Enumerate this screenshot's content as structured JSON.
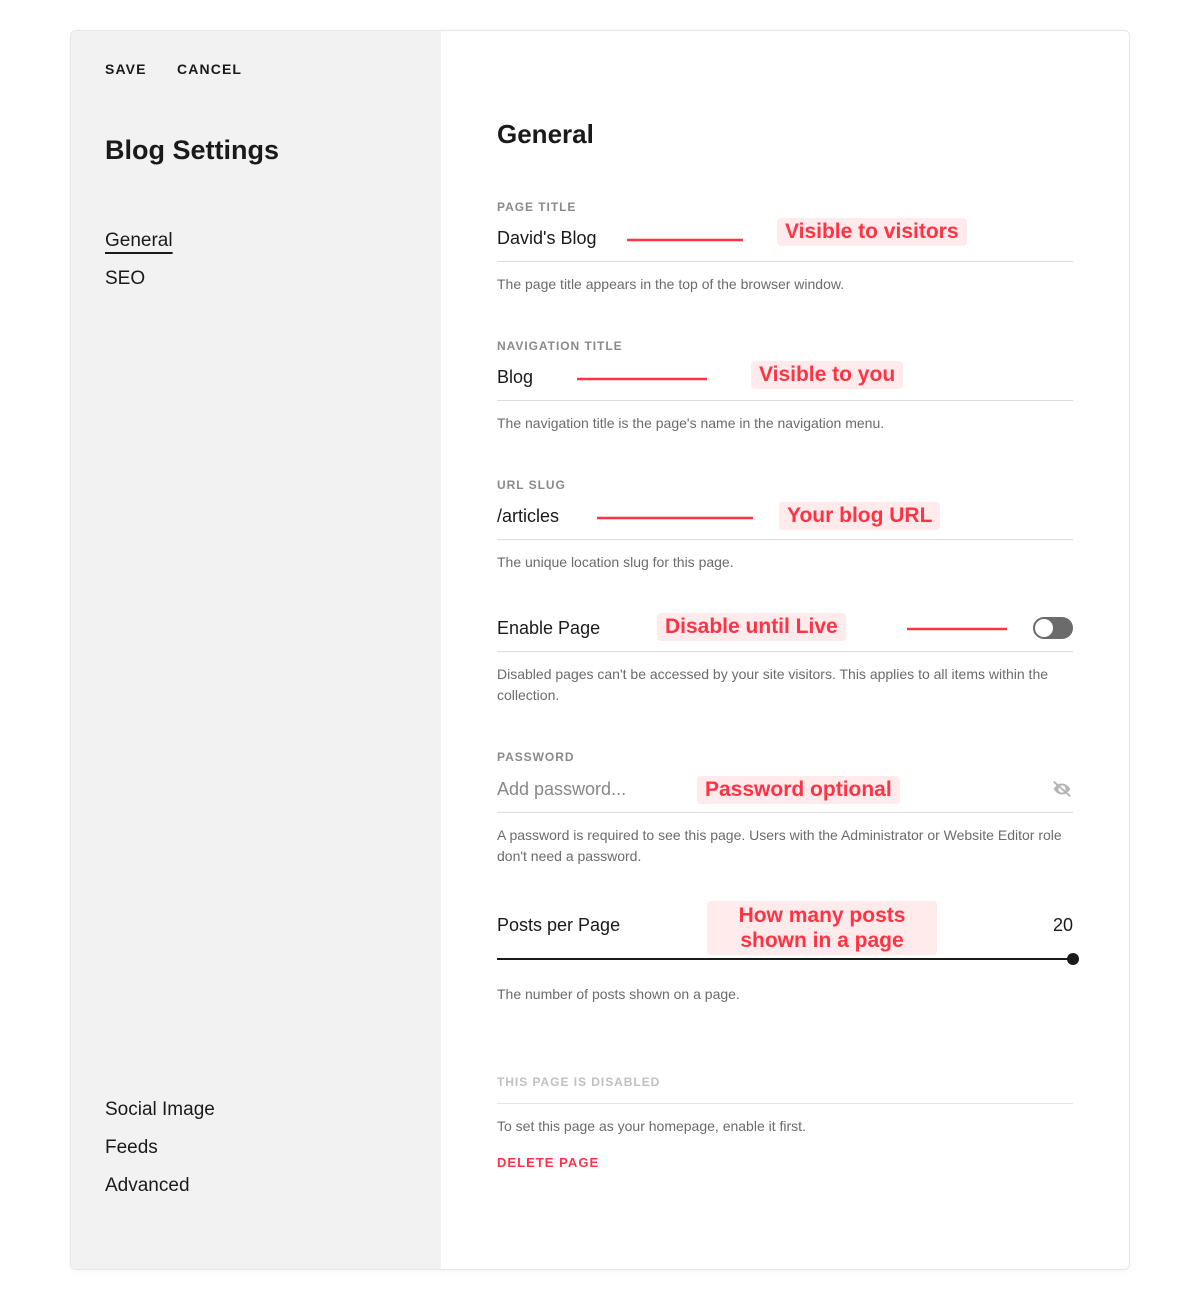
{
  "actions": {
    "save": "SAVE",
    "cancel": "CANCEL"
  },
  "sidebar": {
    "title": "Blog Settings",
    "group1": [
      "General",
      "SEO"
    ],
    "group2": [
      "Social Image",
      "Feeds",
      "Advanced"
    ]
  },
  "main": {
    "heading": "General",
    "page_title": {
      "label": "PAGE TITLE",
      "value": "David's Blog",
      "help": "The page title appears in the top of the browser window."
    },
    "nav_title": {
      "label": "NAVIGATION TITLE",
      "value": "Blog",
      "help": "The navigation title is the page's name in the navigation menu."
    },
    "url_slug": {
      "label": "URL SLUG",
      "value": "/articles",
      "help": "The unique location slug for this page."
    },
    "enable_page": {
      "label": "Enable Page",
      "help": "Disabled pages can't be accessed by your site visitors. This applies to all items within the collection.",
      "value": false
    },
    "password": {
      "label": "PASSWORD",
      "placeholder": "Add password...",
      "help": "A password is required to see this page. Users with the Administrator or Website Editor role don't need a password."
    },
    "posts_per_page": {
      "label": "Posts per Page",
      "value": "20",
      "help": "The number of posts shown on a page."
    },
    "disabled_section": {
      "label": "THIS PAGE IS DISABLED",
      "help": "To set this page as your homepage, enable it first.",
      "delete": "DELETE PAGE"
    }
  },
  "annotations": {
    "visible_to_visitors": "Visible to visitors",
    "visible_to_you": "Visible to you",
    "your_blog_url": "Your blog URL",
    "disable_until_live": "Disable until Live",
    "password_optional": "Password optional",
    "posts_shown": "How many posts shown in a page"
  }
}
